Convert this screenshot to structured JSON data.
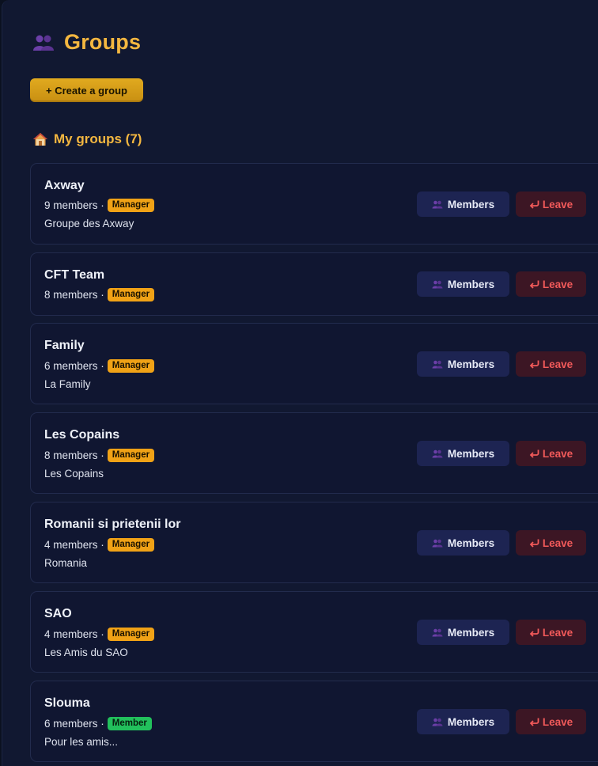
{
  "page": {
    "title": "Groups",
    "create_label": "+ Create a group",
    "section_title": "My groups (7)",
    "icons": {
      "title": "group-icon",
      "section": "house-icon",
      "members": "group-icon",
      "leave": "return-arrow-icon"
    },
    "colors": {
      "accent": "#f4b740",
      "manager_badge": "#f0a216",
      "member_badge": "#22c05c",
      "leave_text": "#f25a5a"
    }
  },
  "groups": [
    {
      "name": "Axway",
      "members_text": "9 members ·",
      "role": "Manager",
      "description": "Groupe des Axway",
      "members_label": "Members",
      "leave_label": "Leave"
    },
    {
      "name": "CFT Team",
      "members_text": "8 members ·",
      "role": "Manager",
      "description": "",
      "members_label": "Members",
      "leave_label": "Leave"
    },
    {
      "name": "Family",
      "members_text": "6 members ·",
      "role": "Manager",
      "description": "La Family",
      "members_label": "Members",
      "leave_label": "Leave"
    },
    {
      "name": "Les Copains",
      "members_text": "8 members ·",
      "role": "Manager",
      "description": "Les Copains",
      "members_label": "Members",
      "leave_label": "Leave"
    },
    {
      "name": "Romanii si prietenii lor",
      "members_text": "4 members ·",
      "role": "Manager",
      "description": "Romania",
      "members_label": "Members",
      "leave_label": "Leave"
    },
    {
      "name": "SAO",
      "members_text": "4 members ·",
      "role": "Manager",
      "description": "Les Amis du SAO",
      "members_label": "Members",
      "leave_label": "Leave"
    },
    {
      "name": "Slouma",
      "members_text": "6 members ·",
      "role": "Member",
      "description": "Pour les amis...",
      "members_label": "Members",
      "leave_label": "Leave"
    }
  ]
}
